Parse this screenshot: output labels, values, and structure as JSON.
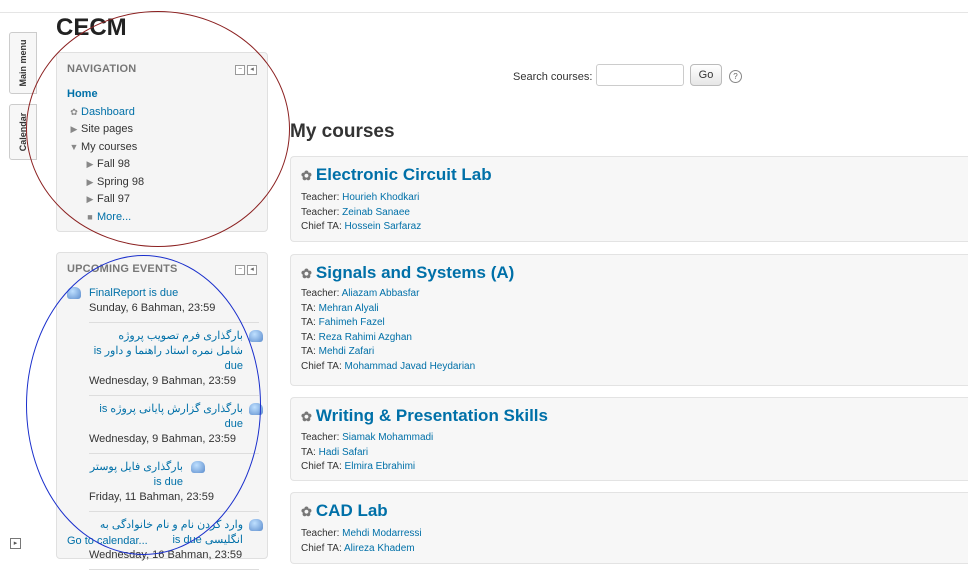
{
  "site": {
    "title": "CECM"
  },
  "side_tabs": {
    "main_menu": "Main menu",
    "calendar": "Calendar"
  },
  "navigation": {
    "title": "NAVIGATION",
    "home": "Home",
    "dashboard": "Dashboard",
    "site_pages": "Site pages",
    "my_courses": "My courses",
    "terms": [
      "Fall 98",
      "Spring 98",
      "Fall 97"
    ],
    "more": "More..."
  },
  "events": {
    "title": "UPCOMING EVENTS",
    "items": [
      {
        "title": "FinalReport is due",
        "date": "Sunday, 6 Bahman,",
        "time": "23:59"
      },
      {
        "title": "بارگذاری فرم تصویب پروژه شامل نمره استاد راهنما و داور is due",
        "date": "Wednesday, 9 Bahman,",
        "time": "23:59"
      },
      {
        "title": "بارگذاری گزارش پایانی پروژه is due",
        "date": "Wednesday, 9 Bahman,",
        "time": "23:59"
      },
      {
        "title": "بارگذاری فایل پوستر is due",
        "date": "Friday, 11 Bahman,",
        "time": "23:59"
      },
      {
        "title": "وارد کردن نام و نام خانوادگی به انگلیسی is due",
        "date": "Wednesday, 16 Bahman,",
        "time": "23:59"
      }
    ],
    "go_to_calendar": "Go to calendar..."
  },
  "search": {
    "label": "Search courses:",
    "value": "",
    "button": "Go"
  },
  "my_courses_heading": "My courses",
  "courses": [
    {
      "name": "Electronic Circuit Lab",
      "staff": [
        {
          "role": "Teacher:",
          "name": "Hourieh Khodkari"
        },
        {
          "role": "Teacher:",
          "name": "Zeinab Sanaee"
        },
        {
          "role": "Chief TA:",
          "name": "Hossein Sarfaraz"
        }
      ]
    },
    {
      "name": "Signals and Systems (A)",
      "staff": [
        {
          "role": "Teacher:",
          "name": "Aliazam Abbasfar"
        },
        {
          "role": "TA:",
          "name": "Mehran Alyali"
        },
        {
          "role": "TA:",
          "name": "Fahimeh Fazel"
        },
        {
          "role": "TA:",
          "name": "Reza Rahimi Azghan"
        },
        {
          "role": "TA:",
          "name": "Mehdi Zafari"
        },
        {
          "role": "Chief TA:",
          "name": "Mohammad Javad Heydarian"
        }
      ]
    },
    {
      "name": "Writing & Presentation Skills",
      "staff": [
        {
          "role": "Teacher:",
          "name": "Siamak Mohammadi"
        },
        {
          "role": "TA:",
          "name": "Hadi Safari"
        },
        {
          "role": "Chief TA:",
          "name": "Elmira Ebrahimi"
        }
      ]
    },
    {
      "name": "CAD Lab",
      "staff": [
        {
          "role": "Teacher:",
          "name": "Mehdi Modarressi"
        },
        {
          "role": "Chief TA:",
          "name": "Alireza Khadem"
        }
      ]
    }
  ]
}
